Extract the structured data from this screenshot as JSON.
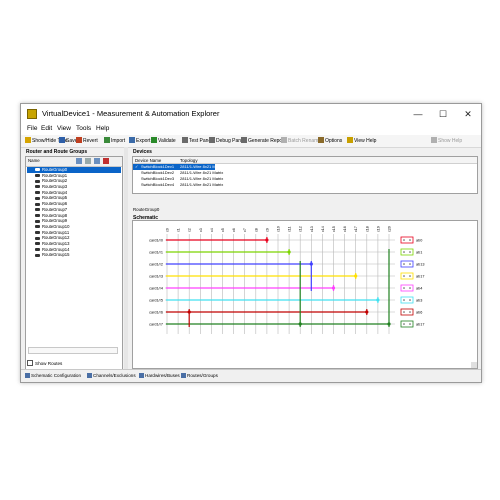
{
  "window": {
    "title": "VirtualDevice1 - Measurement & Automation Explorer",
    "controls": {
      "minimize": "—",
      "maximize": "☐",
      "close": "✕"
    }
  },
  "menu": [
    "File",
    "Edit",
    "View",
    "Tools",
    "Help"
  ],
  "toolbar": {
    "items": [
      {
        "label": "Show/Hide Tree",
        "icon": "tree-icon",
        "color": "#d6a400"
      },
      {
        "label": "Save",
        "icon": "save-icon",
        "color": "#2e5fa8"
      },
      {
        "label": "Revert",
        "icon": "revert-icon",
        "color": "#c04020"
      },
      {
        "label": "Import",
        "icon": "import-icon",
        "color": "#3a8a3a"
      },
      {
        "label": "Export",
        "icon": "export-icon",
        "color": "#3a6aa8"
      },
      {
        "label": "Validate",
        "icon": "validate-icon",
        "color": "#2a8a2a"
      },
      {
        "label": "Test Panel",
        "icon": "test-panel-icon",
        "color": "#6a6a6a"
      },
      {
        "label": "Debug Panel",
        "icon": "debug-panel-icon",
        "color": "#6a6a6a"
      },
      {
        "label": "Generate Report",
        "icon": "report-icon",
        "color": "#6a6a6a"
      },
      {
        "label": "Batch Rename",
        "icon": "rename-icon",
        "color": "#b0b0b0"
      },
      {
        "label": "Options",
        "icon": "options-icon",
        "color": "#8a6a2a"
      },
      {
        "label": "View Help",
        "icon": "help-icon",
        "color": "#c8a000"
      },
      {
        "label": "Show Help",
        "icon": "show-help-icon",
        "color": "#b0b0b0"
      }
    ]
  },
  "left_panel": {
    "title": "Router and Route Groups",
    "column": "Name",
    "groups": [
      "RouteGroup0",
      "RouteGroup1",
      "RouteGroup2",
      "RouteGroup3",
      "RouteGroup4",
      "RouteGroup5",
      "RouteGroup6",
      "RouteGroup7",
      "RouteGroup8",
      "RouteGroup9",
      "RouteGroup10",
      "RouteGroup11",
      "RouteGroup12",
      "RouteGroup13",
      "RouteGroup14",
      "RouteGroup15"
    ],
    "selected_index": 0,
    "show_routes": "Show Routes"
  },
  "devices": {
    "title": "Devices",
    "columns": [
      "Device Name",
      "Topology"
    ],
    "rows": [
      {
        "name": "SwitchBlock1Dev1",
        "topology": "2811/1-Wire 8x21 Matrix",
        "checked": true
      },
      {
        "name": "SwitchBlock1Dev2",
        "topology": "2811/1-Wire 8x21 Matrix",
        "checked": false
      },
      {
        "name": "SwitchBlock1Dev3",
        "topology": "2811/1-Wire 8x21 Matrix",
        "checked": false
      },
      {
        "name": "SwitchBlock1Dev4",
        "topology": "2811/1-Wire 8x21 Matrix",
        "checked": false
      }
    ],
    "check_mark": "✓"
  },
  "route_group_label": "RouteGroup0",
  "schematic": {
    "title": "Schematic",
    "rows": [
      "card1/r0",
      "card1/r1",
      "card1/r2",
      "card1/r3",
      "card1/r4",
      "card1/r5",
      "card1/r6",
      "card1/r7"
    ],
    "columns": [
      "c0",
      "c1",
      "c2",
      "c3",
      "c4",
      "c5",
      "c6",
      "c7",
      "c8",
      "c9",
      "c10",
      "c11",
      "c12",
      "c13",
      "c14",
      "c15",
      "c16",
      "c17",
      "c18",
      "c19",
      "c20"
    ],
    "right_labels": [
      "ab0",
      "ab1",
      "ab13",
      "ab17",
      "ab4",
      "ab3",
      "ab6",
      "ab17"
    ],
    "row_colors": [
      "#e8001c",
      "#7cd400",
      "#4040ff",
      "#ffe000",
      "#ff40ff",
      "#40e0f0",
      "#c00000",
      "#208020"
    ]
  },
  "status_tabs": [
    "Schematic Configuration",
    "Channels/Exclusions",
    "Hardwires/Buses",
    "Routes/Groups"
  ]
}
